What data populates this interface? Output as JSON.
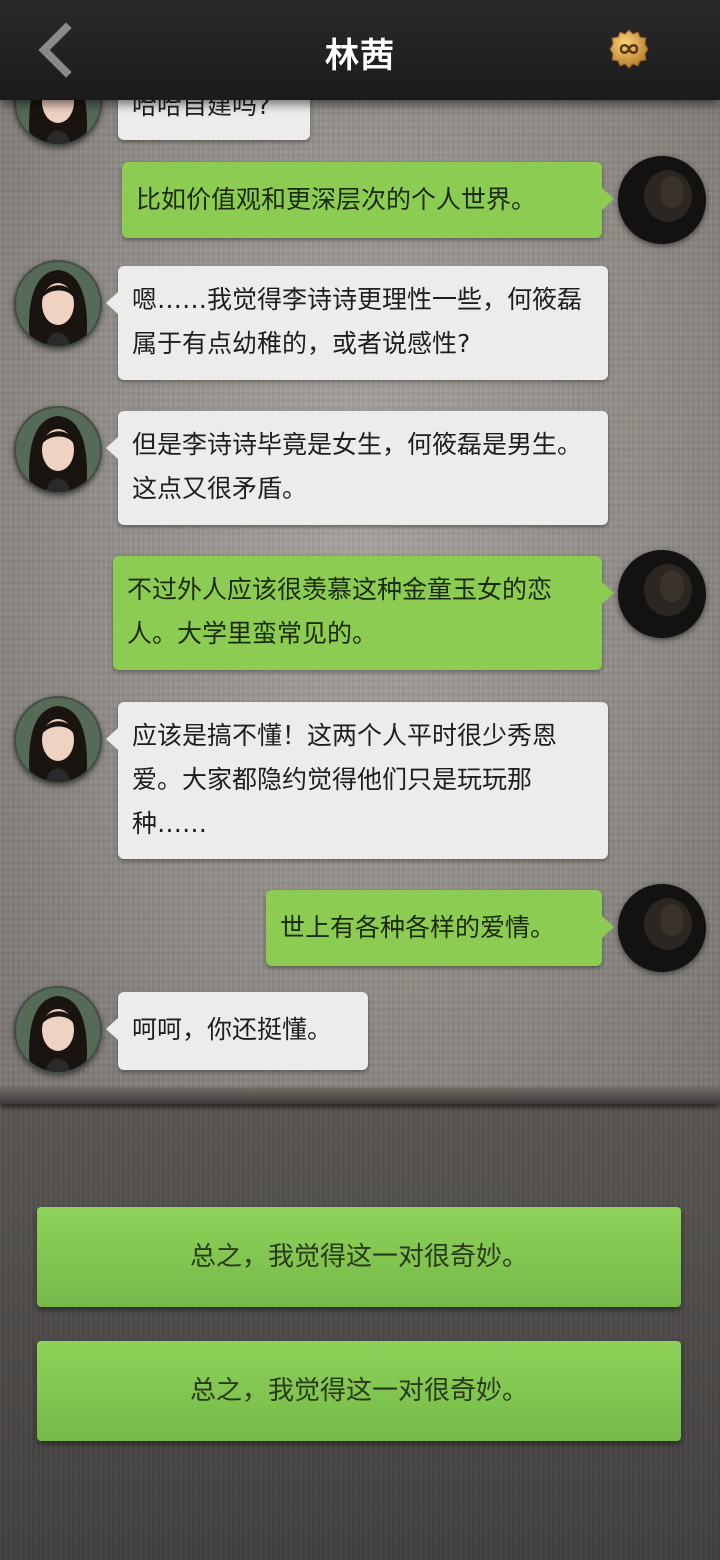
{
  "header": {
    "title": "林茜"
  },
  "messages": [
    {
      "side": "left",
      "text": "哈哈自建吗?",
      "partial": true
    },
    {
      "side": "right",
      "text": "比如价值观和更深层次的个人世界。"
    },
    {
      "side": "left",
      "text": "嗯……我觉得李诗诗更理性一些，何筱磊属于有点幼稚的，或者说感性?"
    },
    {
      "side": "left",
      "text": "但是李诗诗毕竟是女生，何筱磊是男生。这点又很矛盾。"
    },
    {
      "side": "right",
      "text": "不过外人应该很羡慕这种金童玉女的恋人。大学里蛮常见的。"
    },
    {
      "side": "left",
      "text": "应该是搞不懂！这两个人平时很少秀恩爱。大家都隐约觉得他们只是玩玩那种……"
    },
    {
      "side": "right",
      "text": "世上有各种各样的爱情。"
    },
    {
      "side": "left",
      "text": "呵呵，你还挺懂。"
    }
  ],
  "options": [
    {
      "label": "总之，我觉得这一对很奇妙。"
    },
    {
      "label": "总之，我觉得这一对很奇妙。"
    }
  ],
  "icons": {
    "back": "chevron-left-icon",
    "coin": "infinity-coin-icon"
  },
  "colors": {
    "header_bg": "#1f1f1f",
    "incoming_bubble": "#ececec",
    "outgoing_bubble": "#8dcc53",
    "option_button": "#83c651"
  }
}
